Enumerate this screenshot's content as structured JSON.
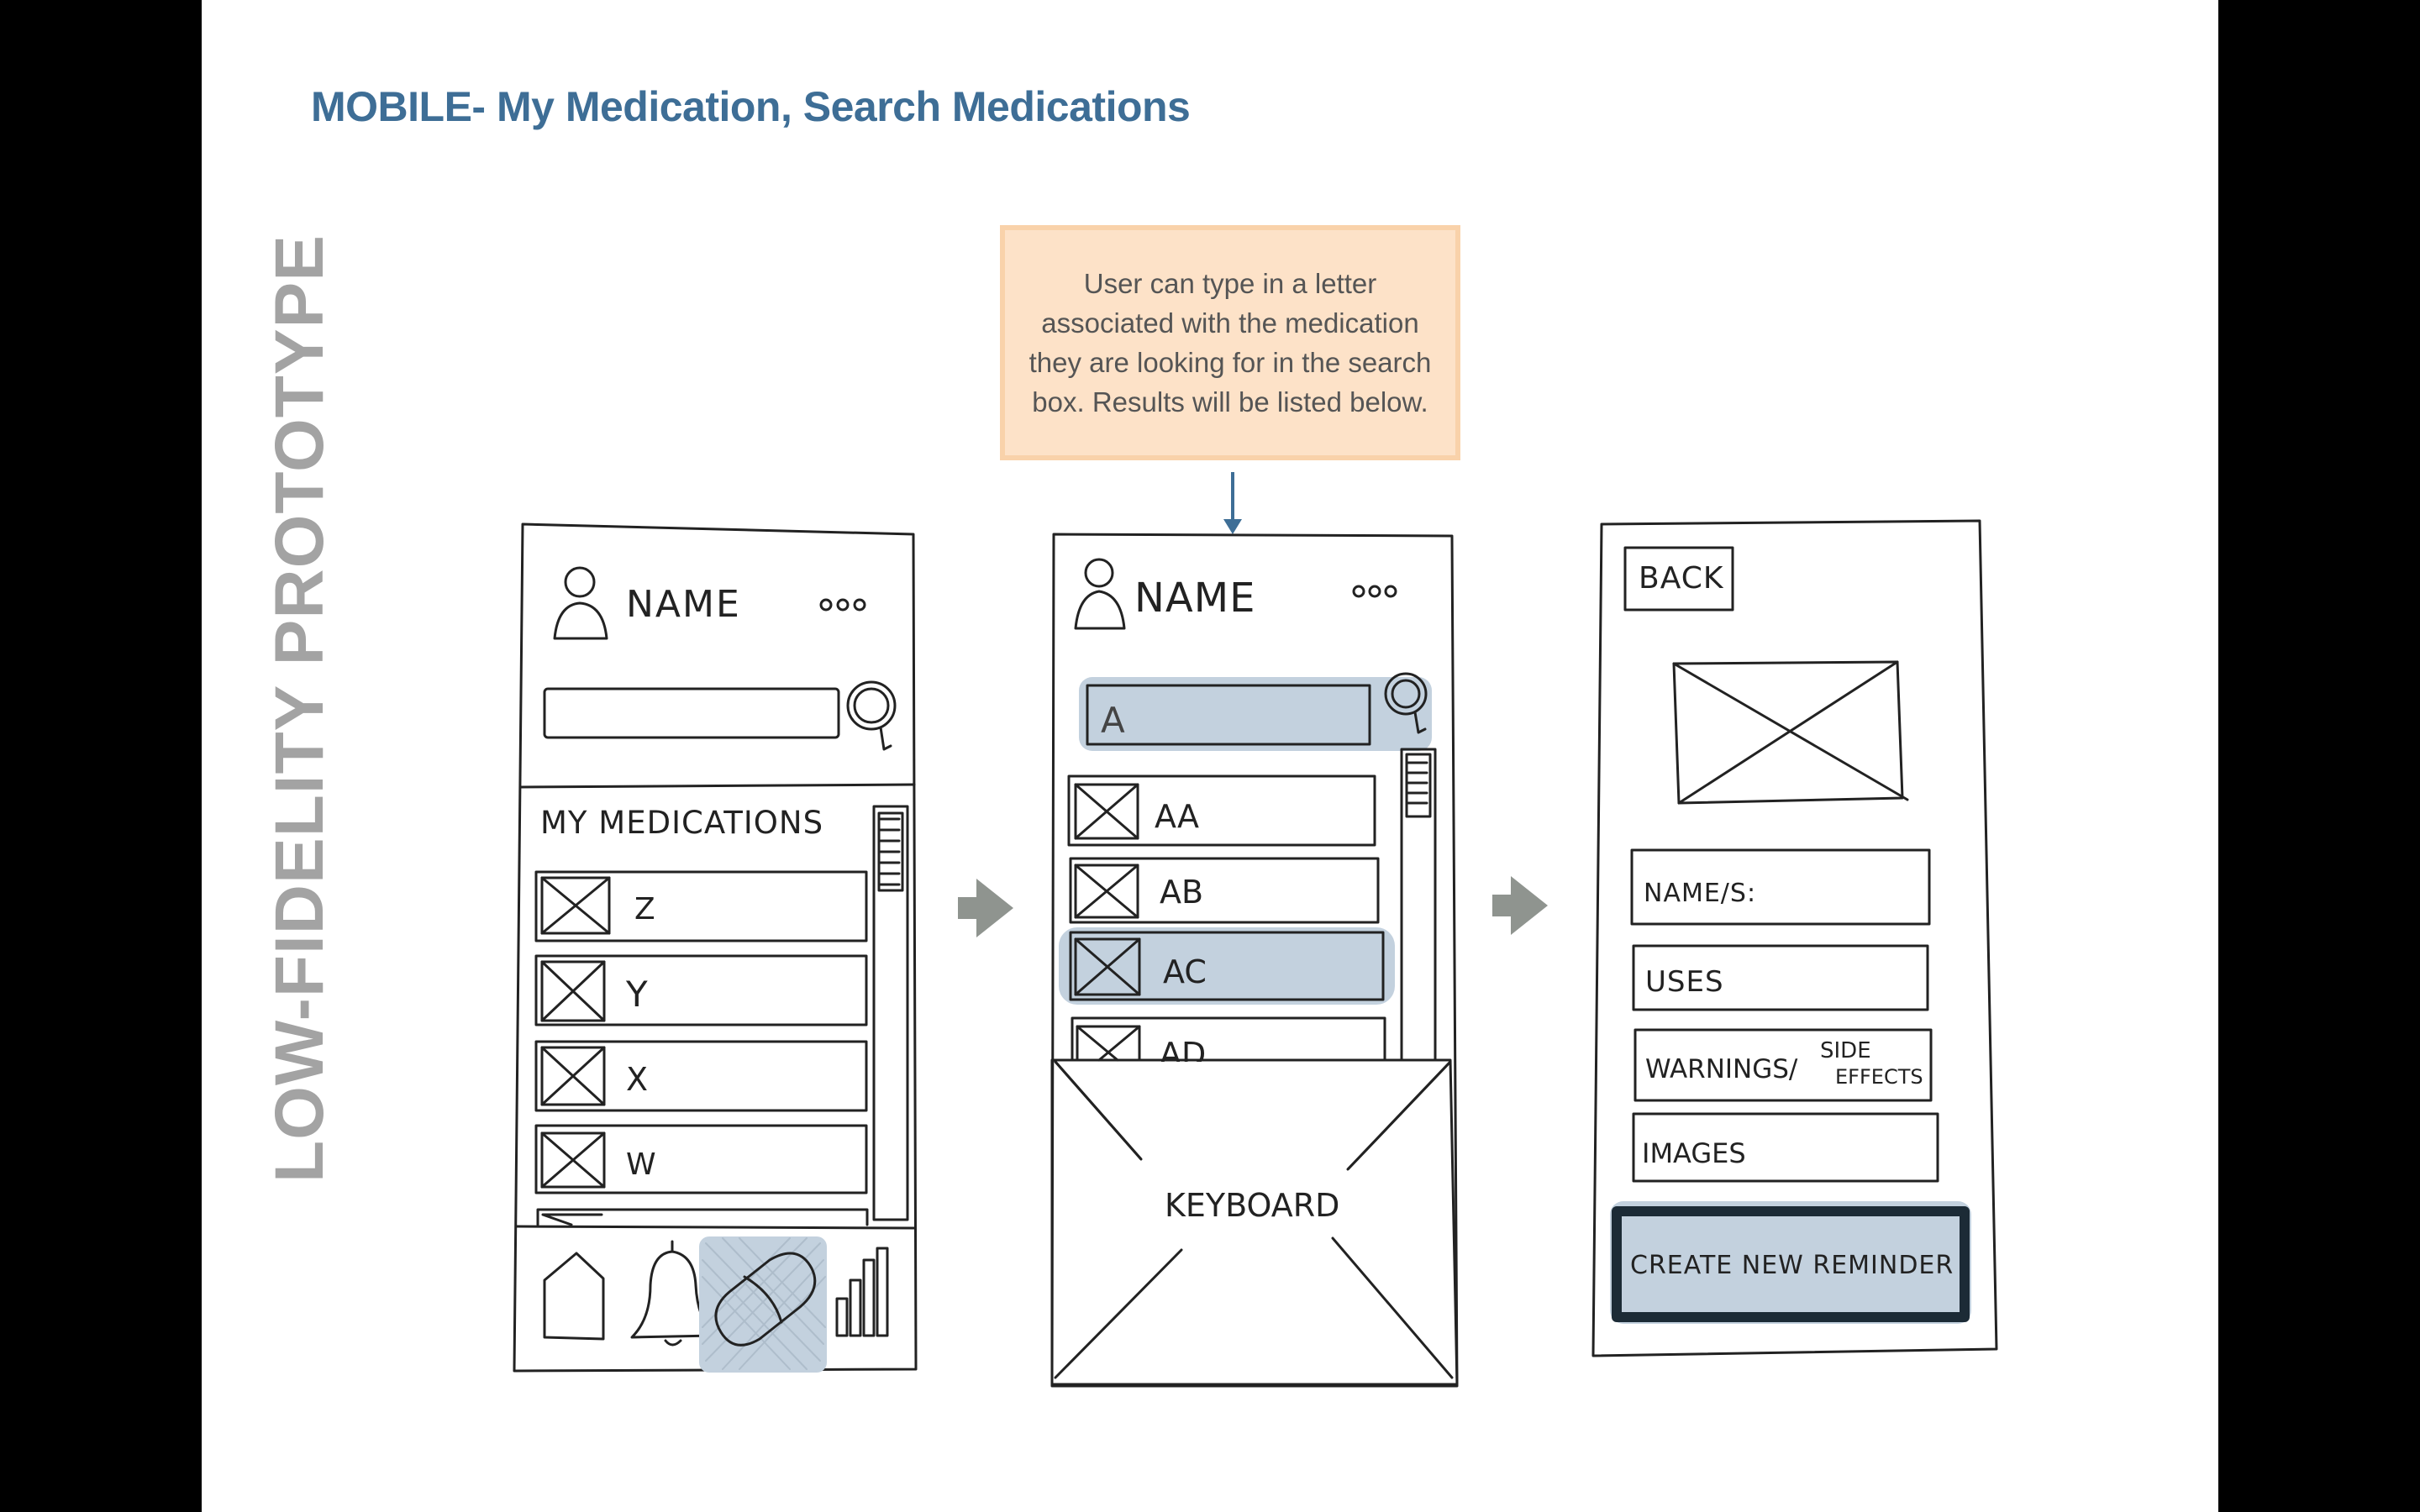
{
  "title": "MOBILE- My Medication, Search Medications",
  "side_label": "LOW-FIDELITY PROTOTYPE",
  "callout_text": "User can type in a letter associated with the medication they are looking for in the search box. Results will be listed below.",
  "colors": {
    "title": "#3e6e96",
    "highlight": "#c3d1de",
    "callout_bg": "#fde2c8",
    "arrow": "#8f948f",
    "side_label": "#a3a3a3"
  },
  "screen1": {
    "profile_name": "NAME",
    "more_dots": "ooo",
    "section_title": "MY MEDICATIONS",
    "list_items": [
      "Z",
      "Y",
      "X",
      "W"
    ],
    "nav_icons": [
      "home-icon",
      "bell-icon",
      "pill-icon",
      "bar-chart-icon"
    ]
  },
  "screen2": {
    "profile_name": "NAME",
    "more_dots": "ooo",
    "search_value": "A",
    "results": [
      "AA",
      "AB",
      "AC",
      "AD"
    ],
    "keyboard_label": "KEYBOARD"
  },
  "screen3": {
    "back_label": "BACK",
    "fields": [
      "NAME/S:",
      "USES",
      "WARNINGS/",
      "IMAGES"
    ],
    "side_effects_top": "SIDE",
    "side_effects_bottom": "EFFECTS",
    "create_button": "CREATE NEW REMINDER"
  }
}
